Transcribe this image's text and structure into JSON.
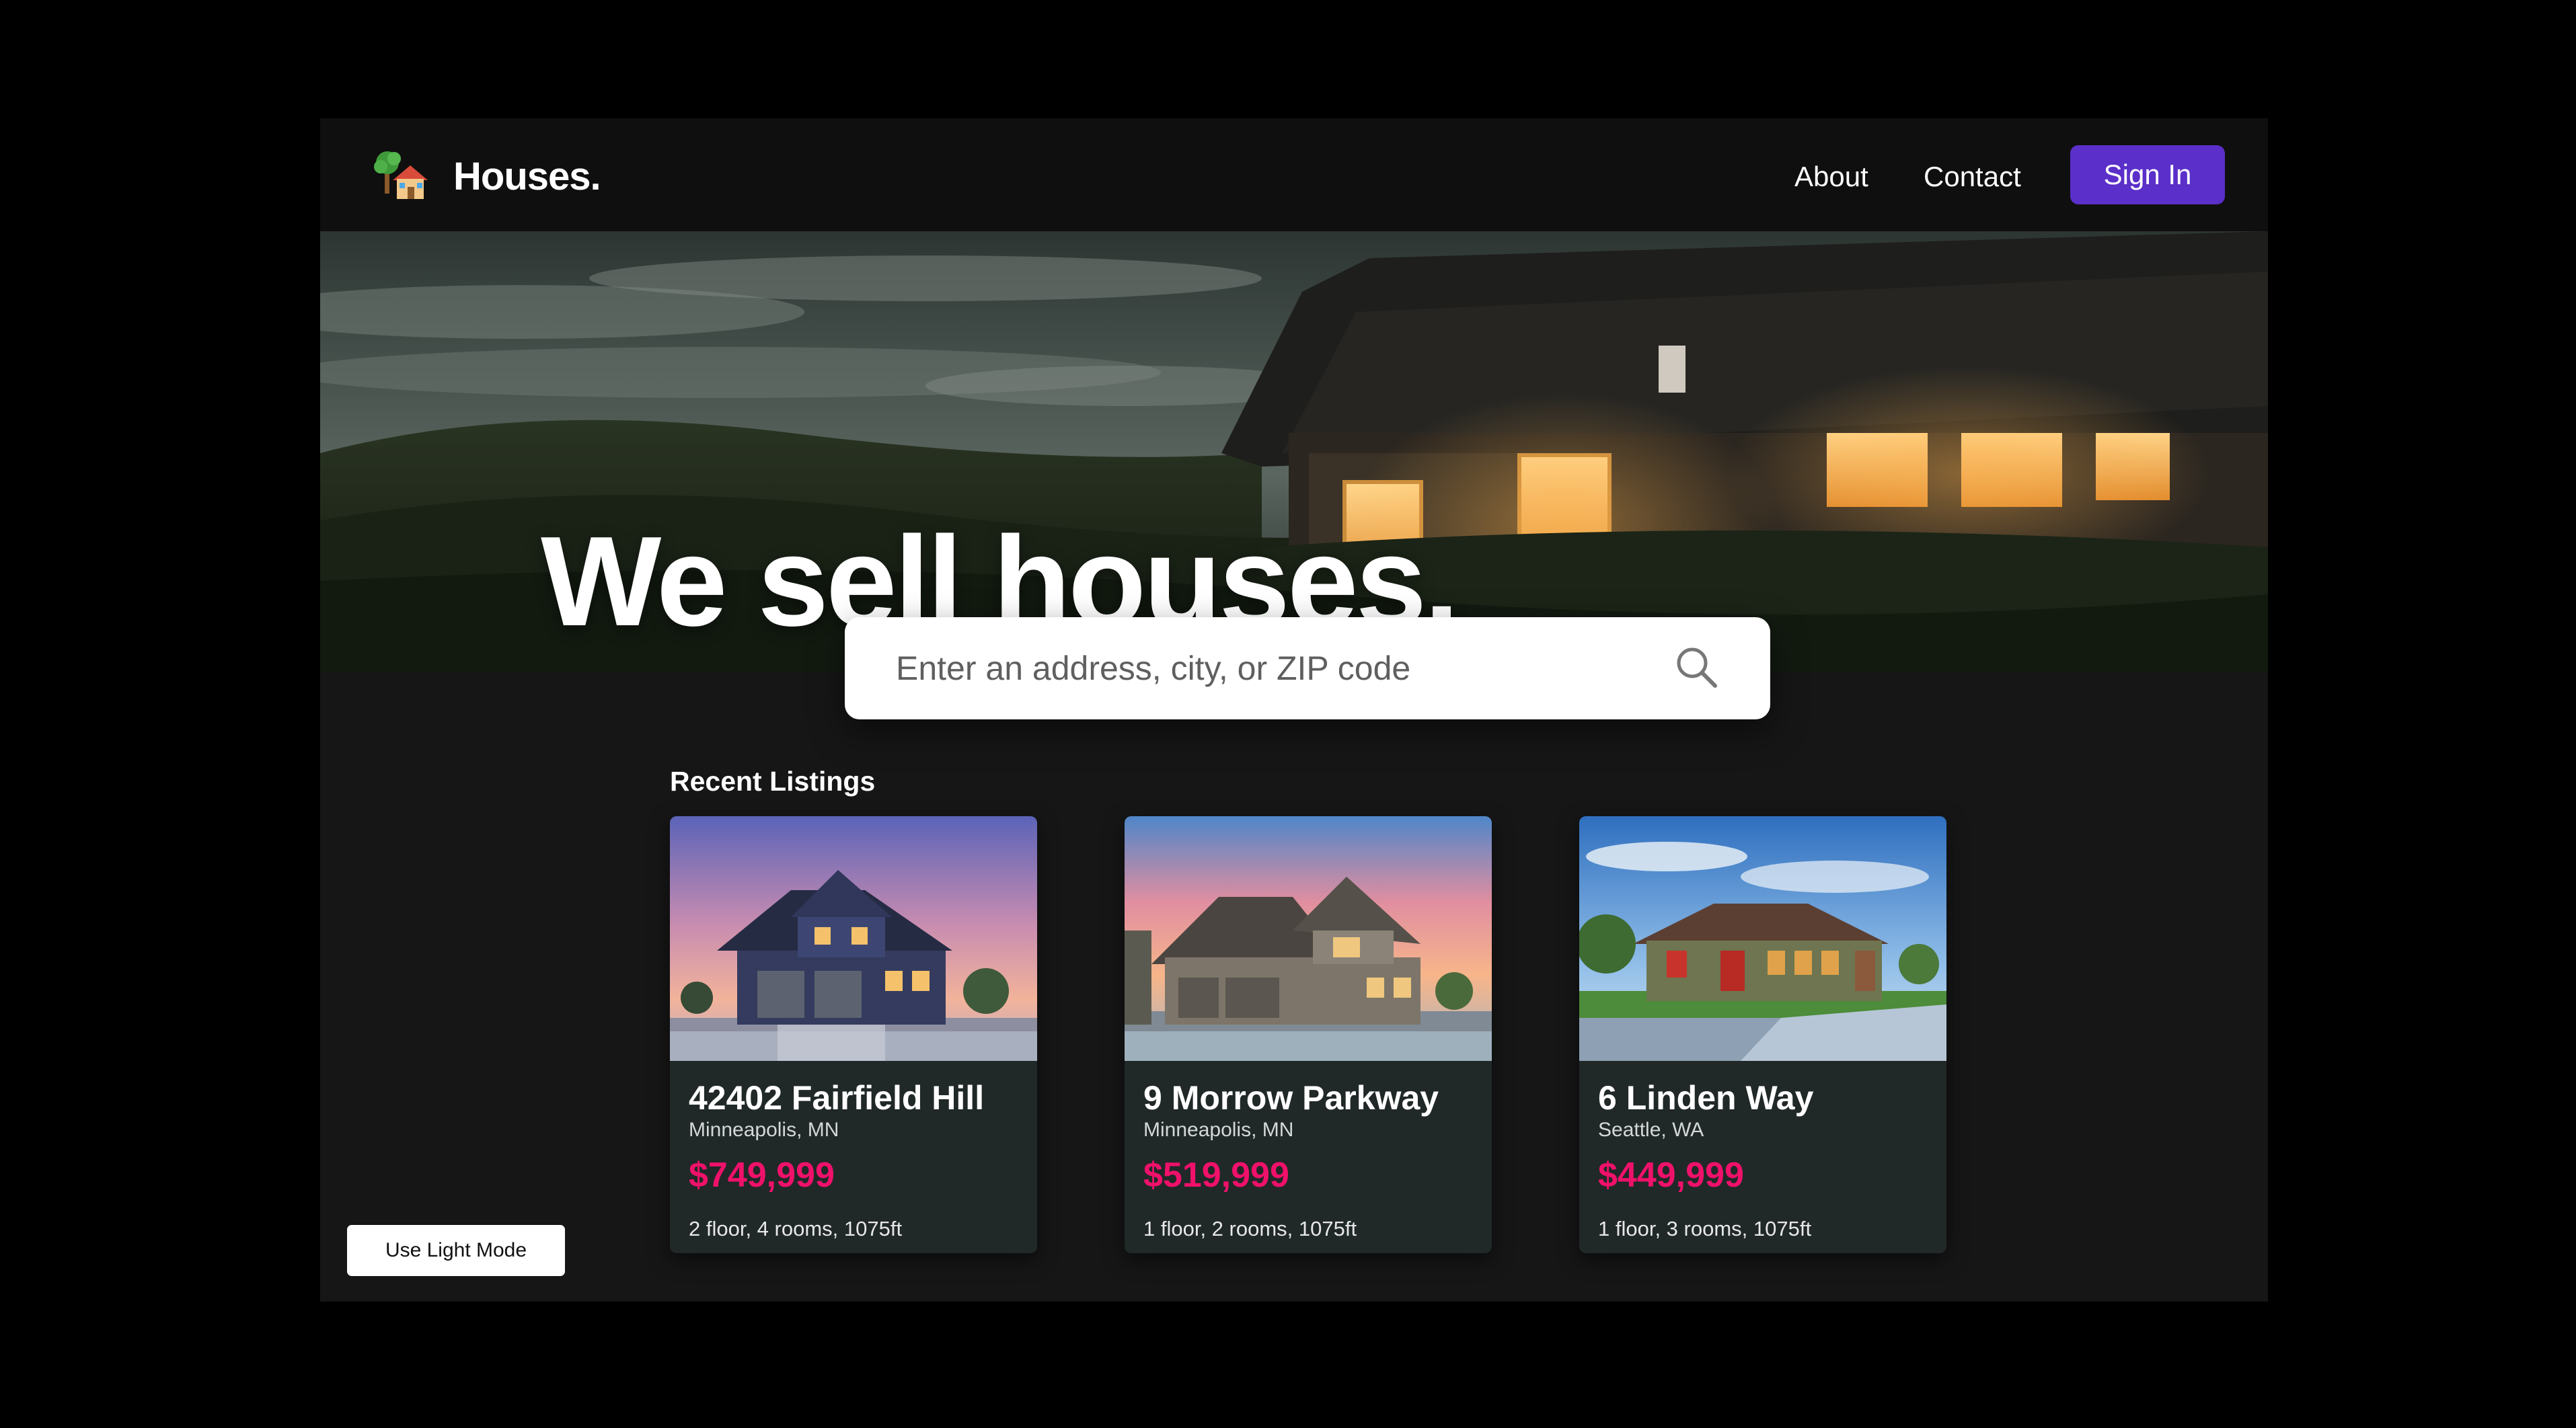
{
  "navbar": {
    "brand": "Houses.",
    "logo_icon": "house-with-tree-icon",
    "links": [
      {
        "label": "About"
      },
      {
        "label": "Contact"
      }
    ],
    "signin_label": "Sign In",
    "signin_color": "#5b2fc9"
  },
  "hero": {
    "title": "We sell houses.",
    "search_placeholder": "Enter an address, city, or ZIP code",
    "search_icon": "search-icon"
  },
  "listings": {
    "title": "Recent Listings",
    "price_color": "#f0116a",
    "items": [
      {
        "address": "42402 Fairfield Hill",
        "city": "Minneapolis, MN",
        "price": "$749,999",
        "details": "2 floor, 4 rooms, 1075ft"
      },
      {
        "address": "9 Morrow Parkway",
        "city": "Minneapolis, MN",
        "price": "$519,999",
        "details": "1 floor, 2 rooms, 1075ft"
      },
      {
        "address": "6 Linden Way",
        "city": "Seattle, WA",
        "price": "$449,999",
        "details": "1 floor, 3 rooms, 1075ft"
      }
    ]
  },
  "theme_toggle": {
    "label": "Use Light Mode"
  }
}
